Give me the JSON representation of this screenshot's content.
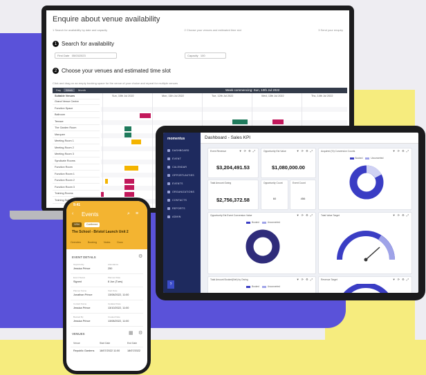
{
  "laptop": {
    "title": "Enquire about venue availability",
    "steps": [
      "1 Search for availability by date and capacity",
      "2 Choose your venues and estimated time slot",
      "3 Send your enquiry"
    ],
    "search_heading": "Search for availability",
    "search_num": "1",
    "first_date_label": "First Date",
    "first_date_value": "05/03/2023",
    "capacity_label": "Capacity",
    "capacity_value": "100",
    "choose_heading": "Choose your venues and estimated time slot",
    "choose_num": "2",
    "hint": "Click and drag on an empty booking space for the venue of your choice and repeat for multiple venues",
    "tabs": [
      "Day",
      "Week",
      "Month"
    ],
    "week_label": "Week commencing: Sun, 10th Jul 2022",
    "venues_header": "Suitable Venues",
    "venues": [
      "Grand Venue Centre",
      "Function Space",
      "Ballroom",
      "Terrace",
      "The Garden Room",
      "Marquee",
      "Meeting Room 1",
      "Meeting Room 2",
      "Meeting Room 3",
      "Syndicate Rooms",
      "Function Room",
      "Function Room 1",
      "Function Room 2",
      "Function Room 3",
      "Training Rooms",
      "Training Suite"
    ],
    "days": [
      "Sun, 10th Jul 2022",
      "Mon, 11th Jul 2022",
      "Tue, 12th Jul 2022",
      "Wed, 13th Jul 2022",
      "Thu, 14th Jul 2022"
    ]
  },
  "tablet": {
    "logo": "momentus",
    "title": "Dashboard - Sales KPI",
    "nav": [
      "DASHBOARD",
      "EVENT",
      "CALENDAR",
      "OPPORTUNITIES",
      "EVENTS",
      "ORGANIZATIONS",
      "CONTACTS",
      "REPORTS",
      "ADMIN"
    ],
    "help": "?",
    "cards": {
      "event_revenue": {
        "title": "Event Revenue",
        "value": "$3,204,491.53"
      },
      "opp_value": {
        "title": "Opportunity Est Value",
        "value": "$1,080,000.00"
      },
      "event_amount": {
        "title": "Total Amount Owing",
        "value": "$2,756,372.58"
      },
      "opp_count": {
        "title": "Opportunity Count",
        "value": "60"
      },
      "event_count": {
        "title": "Event Count",
        "value": "456"
      },
      "donut1_title": "Acquired (%) Conversion Counts",
      "donut2_title": "Opportunity Est Event Conversion Value",
      "gauge1_title": "Total Value Target",
      "bottom1_title": "Total Amount Booked(Net) by Owing",
      "bottom2_title": "Revenue Target",
      "legend_a": "Booked",
      "legend_b": "Unconverted"
    },
    "icons": "▼ ⟳ ⚙ ⤢"
  },
  "phone": {
    "time": "9:41",
    "title": "Events",
    "chip1": "1234",
    "chip2": "Confirmed",
    "event_name": "The School - Bristol Launch Unit 2",
    "tabs": [
      "Overview",
      "Booking",
      "Notes",
      "Docs"
    ],
    "details_heading": "EVENT DETAILS",
    "fields": [
      {
        "label": "Opportunity",
        "value": "Jessica Prince"
      },
      {
        "label": "Attendance",
        "value": "250"
      },
      {
        "label": "Event Status",
        "value": "Signed"
      },
      {
        "label": "Planned Date",
        "value": "8 Jun (Tues)"
      },
      {
        "label": "Planner Name",
        "value": "Jonathan Prince"
      },
      {
        "label": "Start Date",
        "value": "13/08/2022, 11:00"
      },
      {
        "label": "Contact Name",
        "value": "Jessica Prince"
      },
      {
        "label": "Updated Date",
        "value": "13/10/2022, 11:00"
      },
      {
        "label": "Booked By",
        "value": "Jessica Prince"
      },
      {
        "label": "Created Date",
        "value": "13/08/2022, 11:00"
      }
    ],
    "venues_heading": "VENUES",
    "venue_cols": [
      "Venue",
      "Start Date",
      "End Date"
    ],
    "venue_row": [
      "Republic Gardens",
      "18/07/2022 11:00",
      "18/07/2022"
    ]
  }
}
